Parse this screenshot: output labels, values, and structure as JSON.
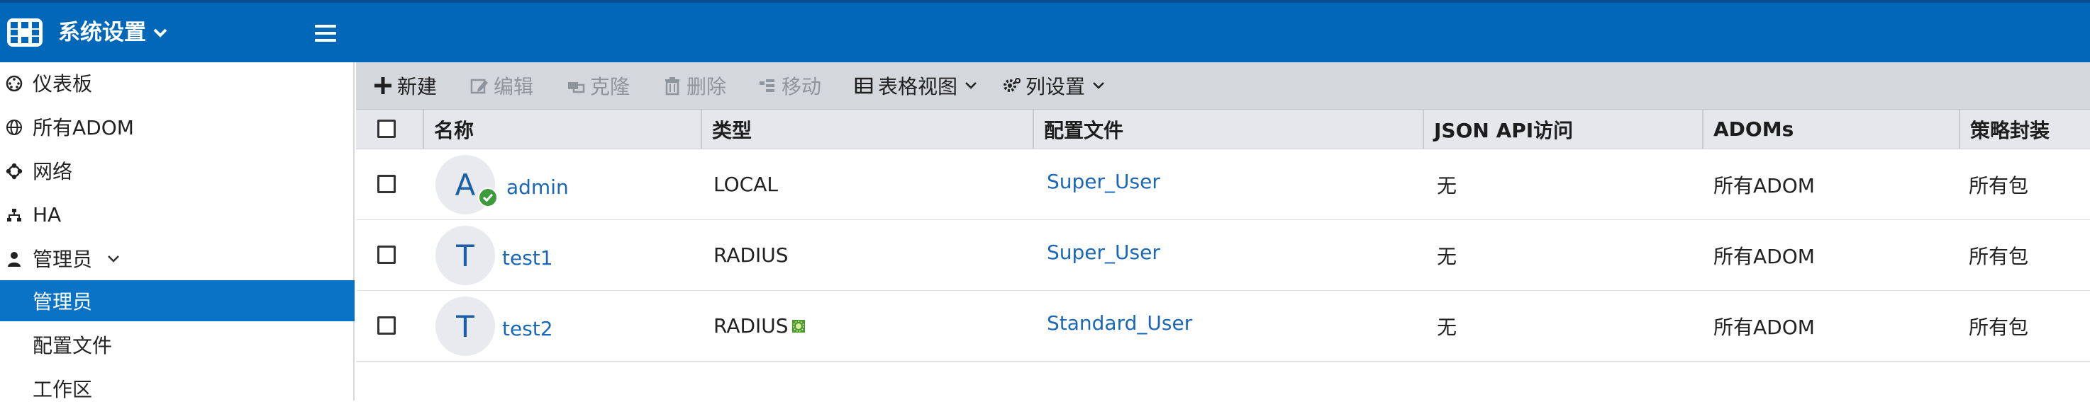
{
  "header": {
    "title": "系统设置"
  },
  "sidebar": {
    "items": [
      {
        "label": "仪表板",
        "icon": "dashboard-icon"
      },
      {
        "label": "所有ADOM",
        "icon": "globe-icon"
      },
      {
        "label": "网络",
        "icon": "network-icon"
      },
      {
        "label": "HA",
        "icon": "ha-icon"
      },
      {
        "label": "管理员",
        "icon": "user-icon"
      }
    ],
    "sub_items": [
      {
        "label": "管理员",
        "active": true
      },
      {
        "label": "配置文件"
      },
      {
        "label": "工作区"
      }
    ]
  },
  "toolbar": {
    "new": "新建",
    "edit": "编辑",
    "clone": "克隆",
    "delete": "删除",
    "move": "移动",
    "table_view": "表格视图",
    "column_settings": "列设置"
  },
  "table": {
    "columns": [
      "名称",
      "类型",
      "配置文件",
      "JSON API访问",
      "ADOMs",
      "策略封装"
    ],
    "rows": [
      {
        "avatar": "A",
        "name": "admin",
        "type": "LOCAL",
        "profile": "Super_User",
        "json_api": "无",
        "adoms": "所有ADOM",
        "policy": "所有包"
      },
      {
        "avatar": "T",
        "name": "test1",
        "type": "RADIUS",
        "profile": "Super_User",
        "json_api": "无",
        "adoms": "所有ADOM",
        "policy": "所有包"
      },
      {
        "avatar": "T",
        "name": "test2",
        "type": "RADIUS",
        "profile": "Standard_User",
        "json_api": "无",
        "adoms": "所有ADOM",
        "policy": "所有包"
      }
    ]
  },
  "colors": {
    "header_bg": "#0067b9",
    "active_bg": "#0a73c6",
    "link": "#1967b6",
    "badge_ok": "#3d9a3d"
  }
}
